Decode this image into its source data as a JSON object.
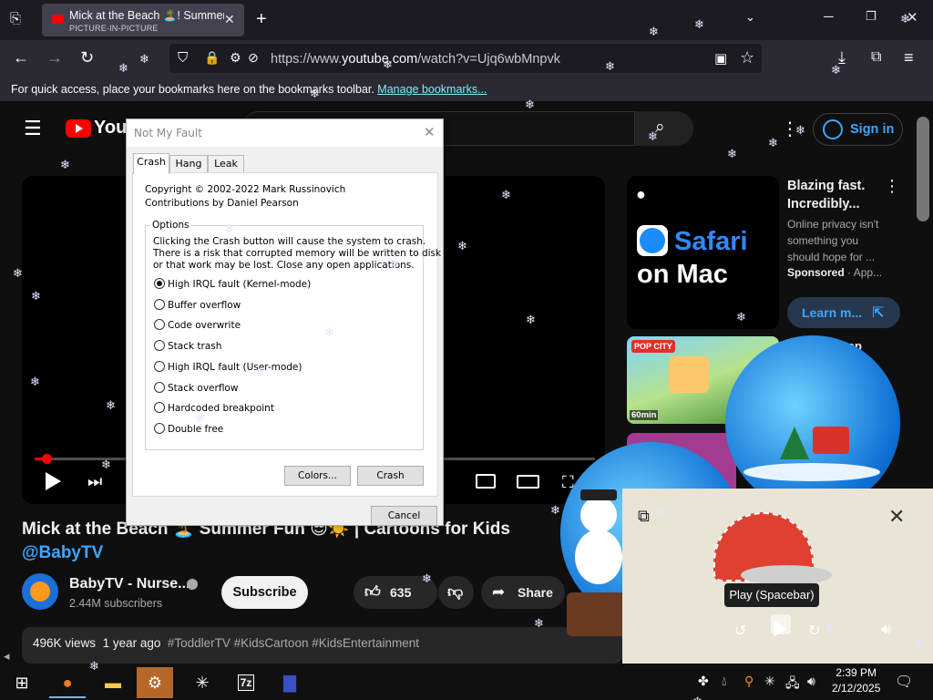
{
  "browser": {
    "tab": {
      "title": "Mick at the Beach 🏝️! Summer",
      "subtitle": "PICTURE-IN-PICTURE"
    },
    "url_prefix": "https://www.",
    "url_domain": "youtube.com",
    "url_path": "/watch?v=Ujq6wbMnpvk",
    "bookmarks_text": "For quick access, place your bookmarks here on the bookmarks toolbar.",
    "bookmarks_link": "Manage bookmarks..."
  },
  "youtube": {
    "logo_text": "YouT",
    "sign_in": "Sign in",
    "video_title": "Mick at the Beach 🏝️ Summer Fun 😎☀️ | Cartoons for Kids",
    "channel_handle": "@BabyTV",
    "channel_name": "BabyTV - Nurse...",
    "subscribers": "2.44M subscribers",
    "subscribe": "Subscribe",
    "likes": "635",
    "share": "Share",
    "views": "496K views",
    "age": "1 year ago",
    "tags": "#ToddlerTV #KidsCartoon #KidsEntertainment"
  },
  "ad": {
    "logo": "Safari",
    "logo_sub": "on Mac",
    "title": "Blazing fast. Incredibly...",
    "body": "Online privacy isn't something you should hope for ...",
    "sponsored": "Sponsored",
    "advertiser": "App...",
    "cta": "Learn m..."
  },
  "recommended": {
    "thumb_label": "POP CITY",
    "duration": "60min",
    "partial_title": "op"
  },
  "pip": {
    "tooltip": "Play (Spacebar)"
  },
  "dialog": {
    "title": "Not My Fault",
    "tabs": [
      "Crash",
      "Hang",
      "Leak"
    ],
    "copyright": "Copyright © 2002-2022 Mark Russinovich",
    "contributions": "Contributions by Daniel Pearson",
    "group_label": "Options",
    "warning_1": "Clicking the Crash button will cause the system to crash.",
    "warning_2": "There is a risk that corrupted memory will be written to disk",
    "warning_3": "or that work may be lost. Close any open applications.",
    "options": [
      "High IRQL fault (Kernel-mode)",
      "Buffer overflow",
      "Code overwrite",
      "Stack trash",
      "High IRQL fault (User-mode)",
      "Stack overflow",
      "Hardcoded breakpoint",
      "Double free"
    ],
    "selected_option": "High IRQL fault (Kernel-mode)",
    "colors_btn": "Colors...",
    "crash_btn": "Crash",
    "cancel_btn": "Cancel"
  },
  "taskbar": {
    "time": "2:39 PM",
    "date": "2/12/2025",
    "sevenzip_label": "7z"
  },
  "colors": {
    "youtube_red": "#ff0000",
    "link_blue": "#3ea6ff",
    "firefox_link": "#80ebff"
  }
}
